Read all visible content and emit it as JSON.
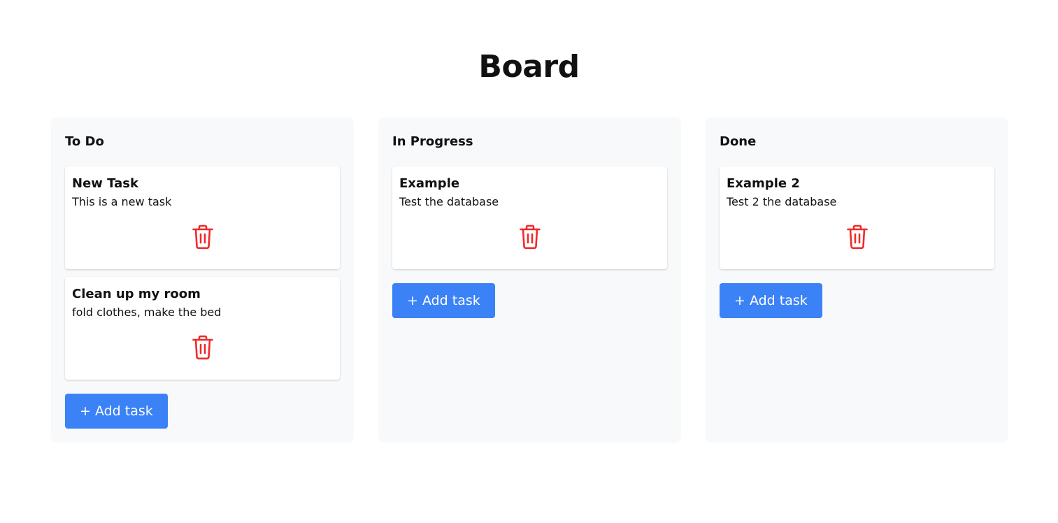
{
  "page": {
    "title": "Board"
  },
  "colors": {
    "accent": "#3b82f6",
    "delete": "#ef2b2b",
    "column_bg": "#f8f9fb"
  },
  "columns": [
    {
      "title": "To Do",
      "add_label": "+ Add task",
      "tasks": [
        {
          "title": "New Task",
          "description": "This is a new task",
          "delete_icon": "trash-icon"
        },
        {
          "title": "Clean up my room",
          "description": "fold clothes, make the bed",
          "delete_icon": "trash-icon"
        }
      ]
    },
    {
      "title": "In Progress",
      "add_label": "+ Add task",
      "tasks": [
        {
          "title": "Example",
          "description": "Test the database",
          "delete_icon": "trash-icon"
        }
      ]
    },
    {
      "title": "Done",
      "add_label": "+ Add task",
      "tasks": [
        {
          "title": "Example 2",
          "description": "Test 2 the database",
          "delete_icon": "trash-icon"
        }
      ]
    }
  ]
}
